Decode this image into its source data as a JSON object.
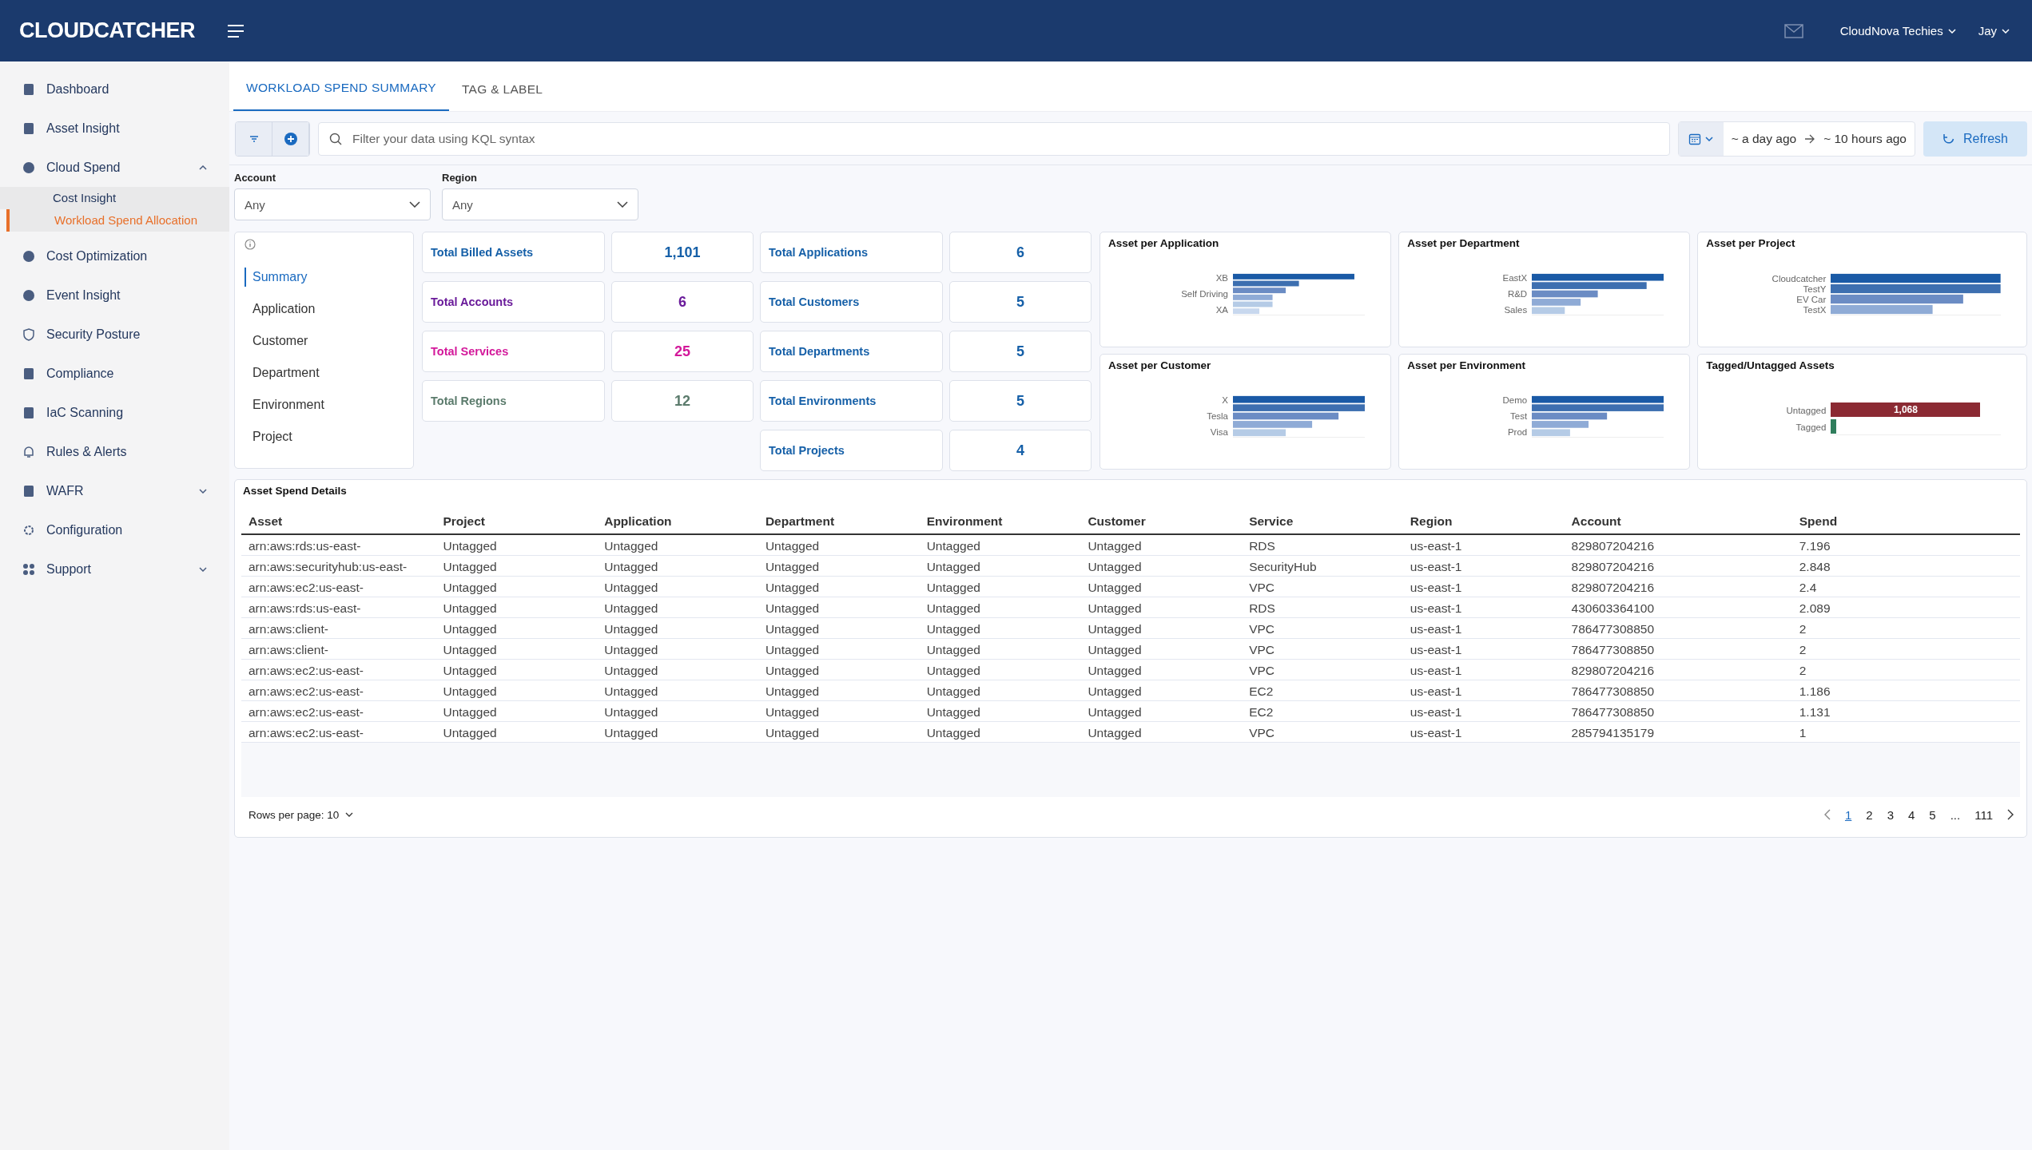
{
  "header": {
    "logo": "CLOUDCATCHER",
    "org": "CloudNova Techies",
    "user": "Jay"
  },
  "sidebar": {
    "items": [
      {
        "label": "Dashboard"
      },
      {
        "label": "Asset Insight"
      },
      {
        "label": "Cloud Spend",
        "expanded": true,
        "children": [
          {
            "label": "Cost Insight",
            "selected": false
          },
          {
            "label": "Workload Spend Allocation",
            "selected": true
          }
        ]
      },
      {
        "label": "Cost Optimization"
      },
      {
        "label": "Event Insight"
      },
      {
        "label": "Security Posture"
      },
      {
        "label": "Compliance"
      },
      {
        "label": "IaC Scanning"
      },
      {
        "label": "Rules & Alerts"
      },
      {
        "label": "WAFR",
        "expanded": false
      },
      {
        "label": "Configuration"
      },
      {
        "label": "Support",
        "expanded": false
      }
    ]
  },
  "tabs": [
    {
      "label": "WORKLOAD SPEND SUMMARY",
      "selected": true
    },
    {
      "label": "TAG & LABEL",
      "selected": false
    }
  ],
  "search": {
    "placeholder": "Filter your data using KQL syntax"
  },
  "date_range": {
    "from": "~ a day ago",
    "to": "~ 10 hours ago"
  },
  "refresh": "Refresh",
  "filters": [
    {
      "label": "Account",
      "value": "Any"
    },
    {
      "label": "Region",
      "value": "Any"
    }
  ],
  "nav": [
    {
      "label": "Summary",
      "selected": true
    },
    {
      "label": "Application",
      "selected": false
    },
    {
      "label": "Customer",
      "selected": false
    },
    {
      "label": "Department",
      "selected": false
    },
    {
      "label": "Environment",
      "selected": false
    },
    {
      "label": "Project",
      "selected": false
    }
  ],
  "stats_left": [
    {
      "label": "Total Billed Assets",
      "value": "1,101",
      "color": "#1660a8"
    },
    {
      "label": "Total Accounts",
      "value": "6",
      "color": "#6a1b9a"
    },
    {
      "label": "Total Services",
      "value": "25",
      "color": "#d3189a"
    },
    {
      "label": "Total Regions",
      "value": "12",
      "color": "#5b7b6c"
    }
  ],
  "stats_right": [
    {
      "label": "Total Applications",
      "value": "6",
      "color": "#1660a8"
    },
    {
      "label": "Total Customers",
      "value": "5",
      "color": "#1660a8"
    },
    {
      "label": "Total Departments",
      "value": "5",
      "color": "#1660a8"
    },
    {
      "label": "Total Environments",
      "value": "5",
      "color": "#1660a8"
    },
    {
      "label": "Total Projects",
      "value": "4",
      "color": "#1660a8"
    }
  ],
  "charts": [
    {
      "title": "Asset per Application",
      "kind": "bars",
      "labels": [
        "XB",
        "Self Driving",
        "XA"
      ]
    },
    {
      "title": "Asset per Department",
      "kind": "bars",
      "labels": [
        "EastX",
        "R&D",
        "Sales"
      ]
    },
    {
      "title": "Asset per Project",
      "kind": "bars",
      "labels": [
        "Cloudcatcher",
        "TestY",
        "EV Car",
        "TestX"
      ]
    },
    {
      "title": "Asset per Customer",
      "kind": "bars",
      "labels": [
        "X",
        "Tesla",
        "Visa"
      ]
    },
    {
      "title": "Asset per Environment",
      "kind": "bars",
      "labels": [
        "Demo",
        "Test",
        "Prod"
      ]
    },
    {
      "title": "Tagged/Untagged Assets",
      "kind": "tagged",
      "labels": [
        "Untagged",
        "Tagged"
      ],
      "value_label": "1,068"
    }
  ],
  "table": {
    "title": "Asset Spend Details",
    "columns": [
      "Asset",
      "Project",
      "Application",
      "Department",
      "Environment",
      "Customer",
      "Service",
      "Region",
      "Account",
      "Spend"
    ],
    "rows": [
      [
        "arn:aws:rds:us-east-",
        "Untagged",
        "Untagged",
        "Untagged",
        "Untagged",
        "Untagged",
        "RDS",
        "us-east-1",
        "829807204216",
        "7.196"
      ],
      [
        "arn:aws:securityhub:us-east-",
        "Untagged",
        "Untagged",
        "Untagged",
        "Untagged",
        "Untagged",
        "SecurityHub",
        "us-east-1",
        "829807204216",
        "2.848"
      ],
      [
        "arn:aws:ec2:us-east-",
        "Untagged",
        "Untagged",
        "Untagged",
        "Untagged",
        "Untagged",
        "VPC",
        "us-east-1",
        "829807204216",
        "2.4"
      ],
      [
        "arn:aws:rds:us-east-",
        "Untagged",
        "Untagged",
        "Untagged",
        "Untagged",
        "Untagged",
        "RDS",
        "us-east-1",
        "430603364100",
        "2.089"
      ],
      [
        "arn:aws:client-",
        "Untagged",
        "Untagged",
        "Untagged",
        "Untagged",
        "Untagged",
        "VPC",
        "us-east-1",
        "786477308850",
        "2"
      ],
      [
        "arn:aws:client-",
        "Untagged",
        "Untagged",
        "Untagged",
        "Untagged",
        "Untagged",
        "VPC",
        "us-east-1",
        "786477308850",
        "2"
      ],
      [
        "arn:aws:ec2:us-east-",
        "Untagged",
        "Untagged",
        "Untagged",
        "Untagged",
        "Untagged",
        "VPC",
        "us-east-1",
        "829807204216",
        "2"
      ],
      [
        "arn:aws:ec2:us-east-",
        "Untagged",
        "Untagged",
        "Untagged",
        "Untagged",
        "Untagged",
        "EC2",
        "us-east-1",
        "786477308850",
        "1.186"
      ],
      [
        "arn:aws:ec2:us-east-",
        "Untagged",
        "Untagged",
        "Untagged",
        "Untagged",
        "Untagged",
        "EC2",
        "us-east-1",
        "786477308850",
        "1.131"
      ],
      [
        "arn:aws:ec2:us-east-",
        "Untagged",
        "Untagged",
        "Untagged",
        "Untagged",
        "Untagged",
        "VPC",
        "us-east-1",
        "285794135179",
        "1"
      ]
    ],
    "rows_per_page": "Rows per page: 10",
    "pages": [
      {
        "label": "1",
        "selected": true
      },
      {
        "label": "2",
        "selected": false
      },
      {
        "label": "3",
        "selected": false
      },
      {
        "label": "4",
        "selected": false
      },
      {
        "label": "5",
        "selected": false
      },
      {
        "label": "...",
        "selected": false
      },
      {
        "label": "111",
        "selected": false
      }
    ]
  }
}
